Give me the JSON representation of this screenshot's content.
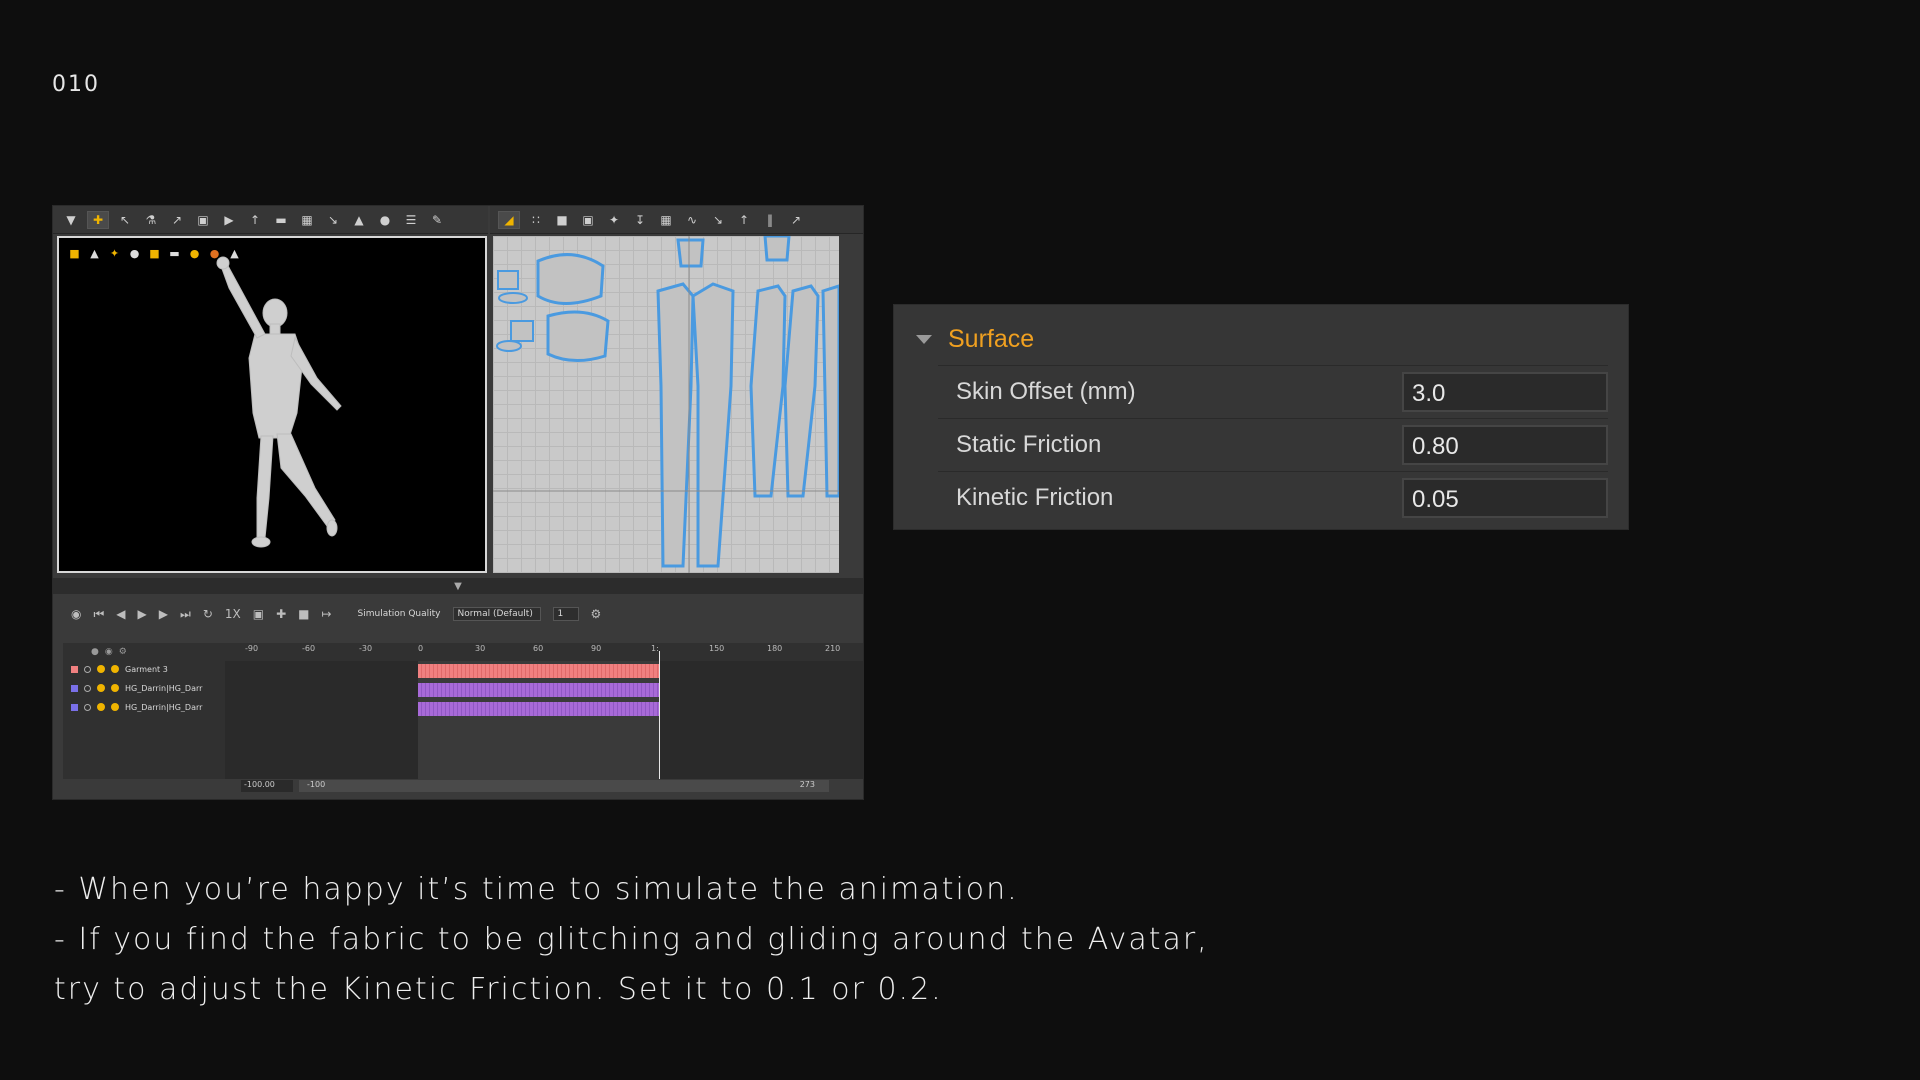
{
  "page_number": "010",
  "app": {
    "simulation_quality_label": "Simulation Quality",
    "simulation_quality_value": "Normal (Default)",
    "simulation_step": "1",
    "speed_label": "1X",
    "tracks": [
      {
        "name": "Garment 3",
        "color": "#f08080"
      },
      {
        "name": "HG_Darrin|HG_Darrin",
        "color": "#a86ad8"
      },
      {
        "name": "HG_Darrin|HG_Darrin",
        "color": "#a86ad8"
      }
    ],
    "ruler_ticks": [
      "-90",
      "-60",
      "-30",
      "0",
      "30",
      "60",
      "90",
      "1:",
      "150",
      "180",
      "210"
    ],
    "scroll_start": "-100.00",
    "range_start": "-100",
    "range_end": "273"
  },
  "surface_panel": {
    "title": "Surface",
    "rows": [
      {
        "label": "Skin Offset (mm)",
        "value": "3.0"
      },
      {
        "label": "Static Friction",
        "value": "0.80"
      },
      {
        "label": "Kinetic Friction",
        "value": "0.05"
      }
    ]
  },
  "notes": [
    "- When you’re happy it’s time to simulate the animation.",
    "- If you find the fabric to be glitching and gliding around the Avatar,",
    "try to adjust the Kinetic Friction. Set it to 0.1 or 0.2."
  ]
}
